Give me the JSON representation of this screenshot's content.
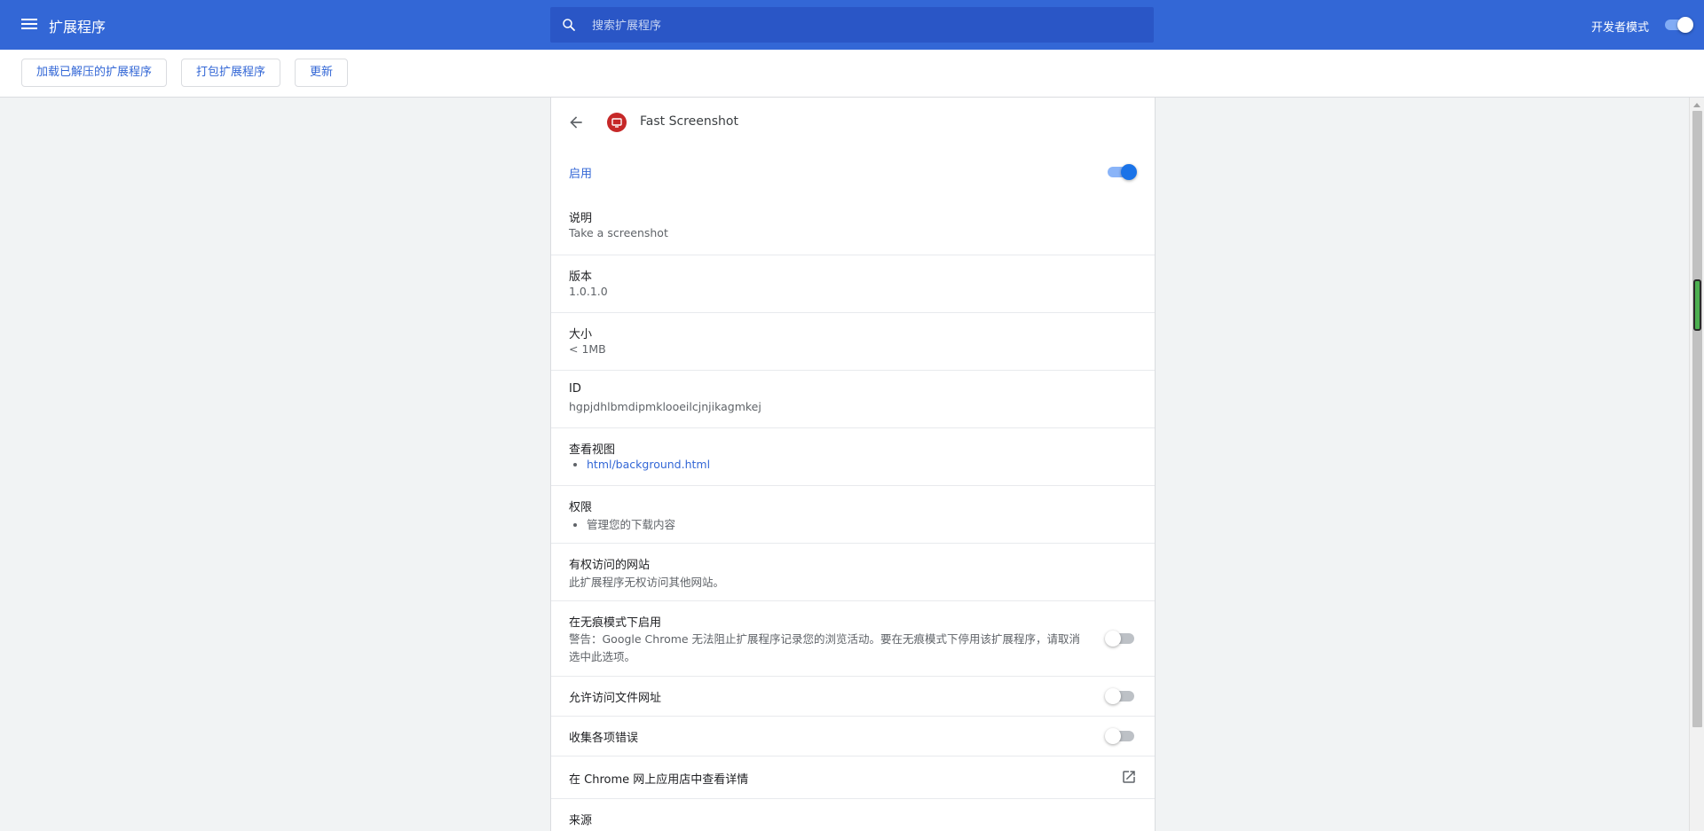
{
  "app": {
    "title": "扩展程序",
    "search_placeholder": "搜索扩展程序",
    "dev_mode_label": "开发者模式",
    "dev_mode_on": true
  },
  "toolbar": {
    "load_unpacked": "加载已解压的扩展程序",
    "pack_extension": "打包扩展程序",
    "update": "更新"
  },
  "extension": {
    "name": "Fast Screenshot",
    "enable_label": "启用",
    "enabled": true,
    "description_title": "说明",
    "description": "Take a screenshot",
    "version_title": "版本",
    "version": "1.0.1.0",
    "size_title": "大小",
    "size": "< 1MB",
    "id_title": "ID",
    "id": "hgpjdhlbmdipmklooeilcjnjikagmkej",
    "views_title": "查看视图",
    "views": [
      "html/background.html"
    ],
    "permissions_title": "权限",
    "permissions": [
      "管理您的下载内容"
    ],
    "site_access_title": "有权访问的网站",
    "site_access": "此扩展程序无权访问其他网站。",
    "incognito_title": "在无痕模式下启用",
    "incognito_warning": "警告：Google Chrome 无法阻止扩展程序记录您的浏览活动。要在无痕模式下停用该扩展程序，请取消选中此选项。",
    "incognito_enabled": false,
    "file_access_label": "允许访问文件网址",
    "file_access_enabled": false,
    "collect_errors_label": "收集各项错误",
    "collect_errors_enabled": false,
    "webstore_label": "在 Chrome 网上应用店中查看详情",
    "source_title": "来源"
  },
  "colors": {
    "topbar": "#3367d6",
    "accent": "#1a73e8",
    "extension_icon": "#c62828"
  }
}
